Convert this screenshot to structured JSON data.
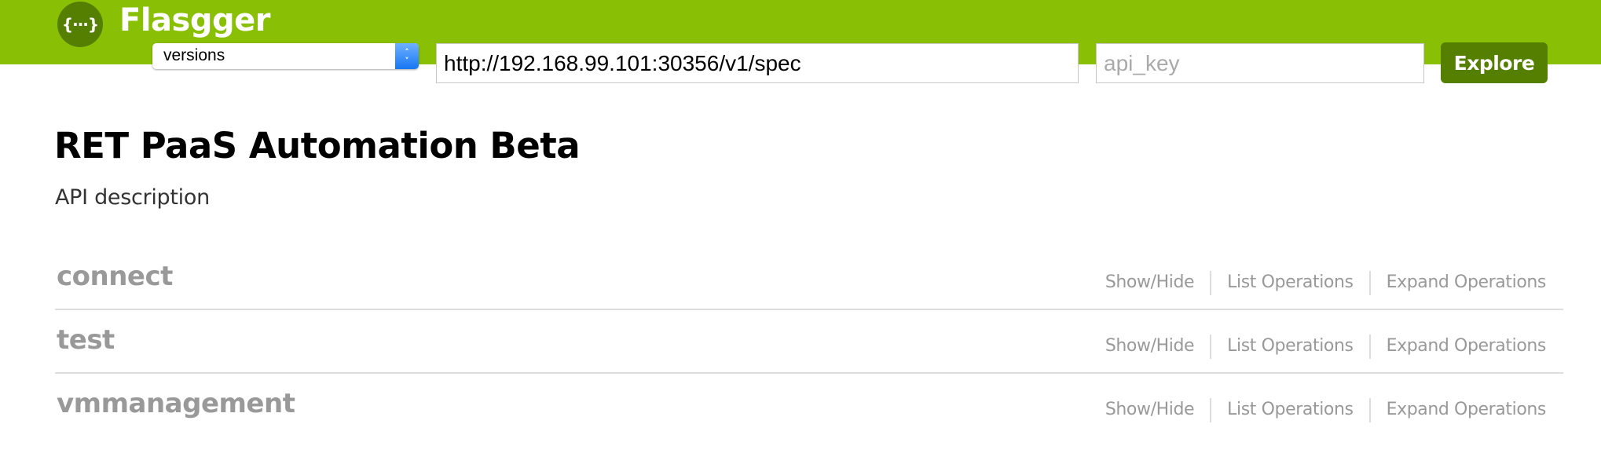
{
  "header": {
    "logo_glyph": "{···}",
    "logo_icon": "braces-icon",
    "brand": "Flasgger",
    "version_select": {
      "selected": "versions",
      "stepper_up": "⌃",
      "stepper_down": "⌄"
    },
    "url_input": {
      "value": "http://192.168.99.101:30356/v1/spec",
      "placeholder": ""
    },
    "api_key_input": {
      "value": "",
      "placeholder": "api_key"
    },
    "explore_label": "Explore",
    "colors": {
      "header_bg": "#89bf04",
      "button_bg": "#547f00"
    }
  },
  "info": {
    "title": "RET PaaS Automation Beta",
    "description": "API description"
  },
  "resources": [
    {
      "name": "connect",
      "ops": [
        "Show/Hide",
        "List Operations",
        "Expand Operations"
      ]
    },
    {
      "name": "test",
      "ops": [
        "Show/Hide",
        "List Operations",
        "Expand Operations"
      ]
    },
    {
      "name": "vmmanagement",
      "ops": [
        "Show/Hide",
        "List Operations",
        "Expand Operations"
      ]
    }
  ]
}
